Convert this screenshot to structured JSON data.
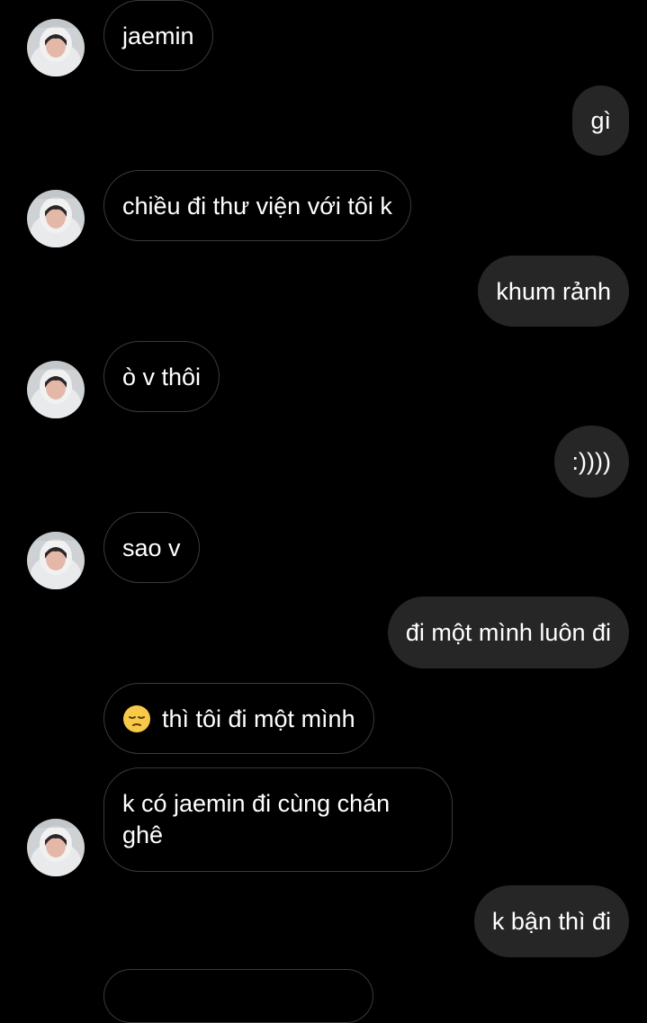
{
  "conversation": {
    "messages": [
      {
        "side": "in",
        "text": "jaemin"
      },
      {
        "side": "out",
        "text": "gì"
      },
      {
        "side": "in",
        "text": "chiều đi thư viện với tôi k"
      },
      {
        "side": "out",
        "text": "khum rảnh"
      },
      {
        "side": "in",
        "text": "ò v thôi"
      },
      {
        "side": "out",
        "text": ":))))"
      },
      {
        "side": "in",
        "text": "sao v"
      },
      {
        "side": "out",
        "text": "đi một mình luôn đi"
      },
      {
        "side": "in",
        "text": "thì tôi đi một mình",
        "emoji": "pensive-face-icon"
      },
      {
        "side": "in",
        "text": "k có jaemin đi cùng chán ghê"
      },
      {
        "side": "out",
        "text": "k bận thì đi"
      }
    ]
  },
  "theme": {
    "background": "#000000",
    "incoming_border": "#3a3a3a",
    "outgoing_bubble": "#262626",
    "text": "#ffffff"
  }
}
